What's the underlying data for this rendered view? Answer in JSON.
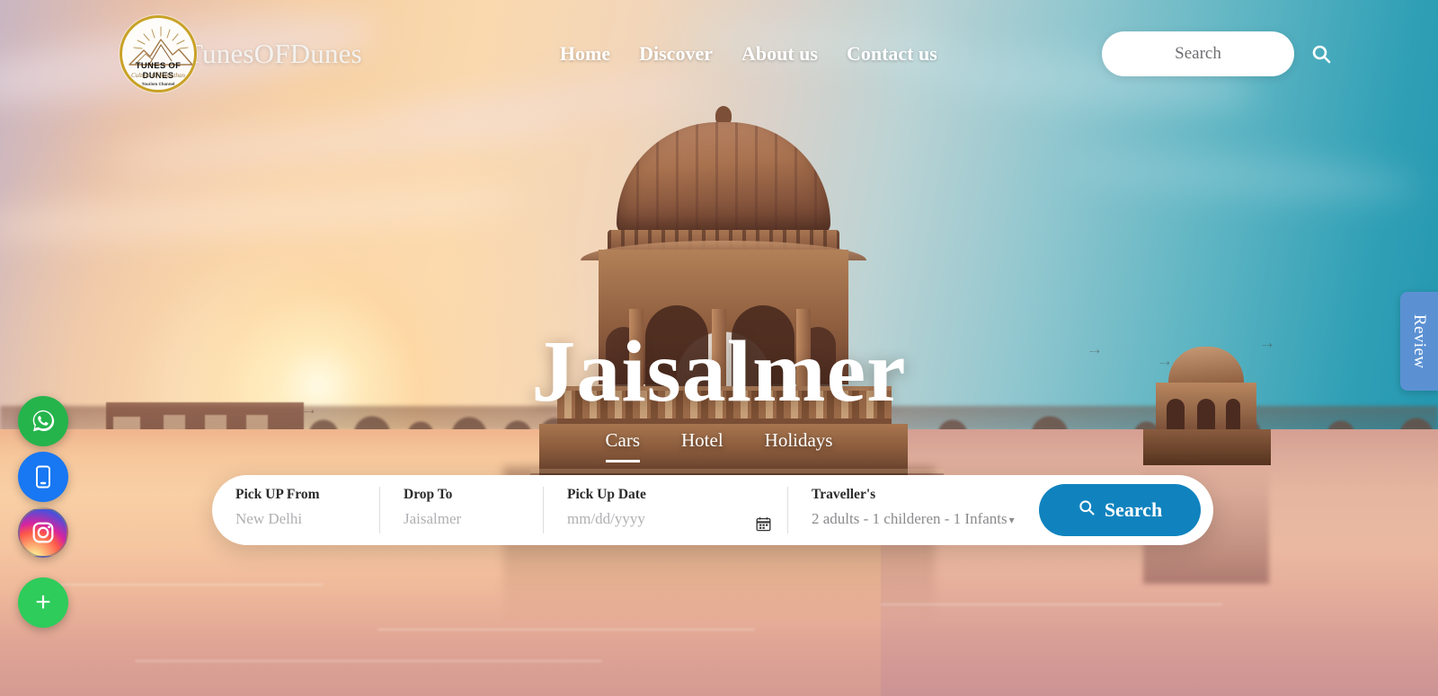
{
  "header": {
    "brand_name": "TunesOFDunes",
    "logo": {
      "name": "TUNES OF DUNES",
      "tagline": "Culture Of Rajasthan",
      "sub": "Tourism Channel",
      "icon": "mountain-sunrise-icon"
    },
    "nav": [
      {
        "label": "Home"
      },
      {
        "label": "Discover"
      },
      {
        "label": "About us"
      },
      {
        "label": "Contact us"
      }
    ],
    "search": {
      "placeholder": "Search",
      "value": "",
      "icon": "search-icon"
    }
  },
  "hero": {
    "title": "Jaisalmer",
    "tabs": [
      {
        "label": "Cars",
        "active": true
      },
      {
        "label": "Hotel",
        "active": false
      },
      {
        "label": "Holidays",
        "active": false
      }
    ]
  },
  "booking": {
    "pickup": {
      "label": "Pick UP From",
      "value": "New Delhi",
      "placeholder": "New Delhi"
    },
    "drop": {
      "label": "Drop To",
      "value": "Jaisalmer",
      "placeholder": "Jaisalmer"
    },
    "date": {
      "label": "Pick Up Date",
      "value": "",
      "placeholder": "mm/dd/yyyy",
      "icon": "calendar-icon"
    },
    "travellers": {
      "label": "Traveller's",
      "value": "2 adults - 1 childeren - 1 Infants",
      "caret": "▾"
    },
    "search_button": {
      "label": "Search",
      "icon": "search-icon"
    }
  },
  "floating_buttons": [
    {
      "name": "whatsapp",
      "icon": "whatsapp-icon",
      "color": "#25b44c"
    },
    {
      "name": "phone",
      "icon": "mobile-phone-icon",
      "color": "#1877f2"
    },
    {
      "name": "instagram",
      "icon": "instagram-icon",
      "color": "#d6249f"
    },
    {
      "name": "add",
      "icon": "plus-icon",
      "label": "+",
      "color": "#2ecc5b"
    }
  ],
  "review_tab": {
    "label": "Review",
    "color": "#5b91d3"
  },
  "colors": {
    "accent_blue": "#1083be",
    "review_blue": "#5b91d3",
    "logo_gold": "#c9a227",
    "card_white": "#ffffff"
  }
}
